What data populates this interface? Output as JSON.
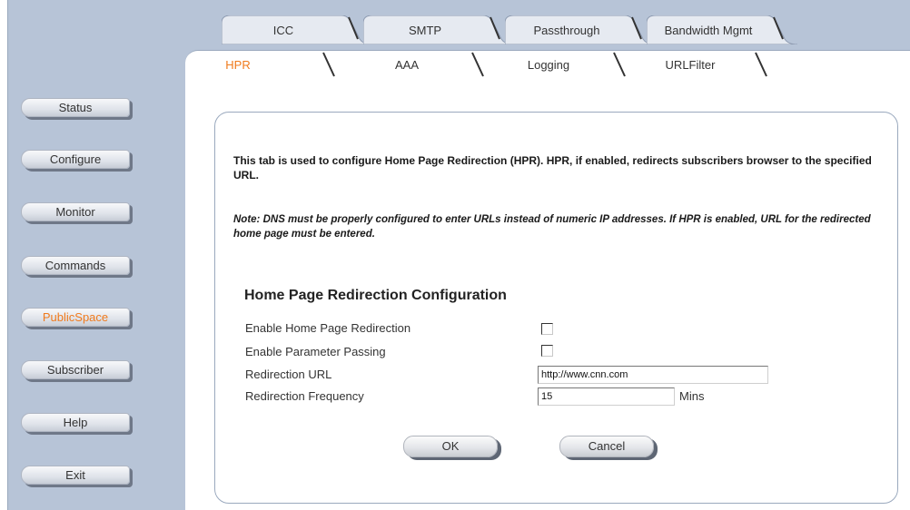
{
  "sidebar": {
    "items": [
      {
        "label": "Status",
        "active": false
      },
      {
        "label": "Configure",
        "active": false
      },
      {
        "label": "Monitor",
        "active": false
      },
      {
        "label": "Commands",
        "active": false
      },
      {
        "label": "PublicSpace",
        "active": true
      },
      {
        "label": "Subscriber",
        "active": false
      },
      {
        "label": "Help",
        "active": false
      },
      {
        "label": "Exit",
        "active": false
      }
    ]
  },
  "tabs": {
    "row1": [
      "ICC",
      "SMTP",
      "Passthrough",
      "Bandwidth Mgmt"
    ],
    "row2": [
      "HPR",
      "AAA",
      "Logging",
      "URLFilter"
    ],
    "active": "HPR"
  },
  "content": {
    "intro": "This tab is used to configure Home Page Redirection (HPR). HPR, if enabled, redirects subscribers browser to the specified URL.",
    "note": "Note: DNS must be properly configured to enter URLs instead of numeric IP addresses. If HPR is enabled, URL for the redirected home page must be entered.",
    "section_title": "Home Page Redirection Configuration",
    "fields": {
      "enable_hpr_label": "Enable Home Page Redirection",
      "enable_hpr_checked": false,
      "enable_param_label": "Enable Parameter Passing",
      "enable_param_checked": false,
      "url_label": "Redirection URL",
      "url_value": "http://www.cnn.com",
      "freq_label": "Redirection Frequency",
      "freq_value": "15",
      "freq_unit": "Mins"
    },
    "ok_label": "OK",
    "cancel_label": "Cancel"
  },
  "colors": {
    "sidebar_bg": "#b7c4d7",
    "active_accent": "#f07a1c"
  }
}
